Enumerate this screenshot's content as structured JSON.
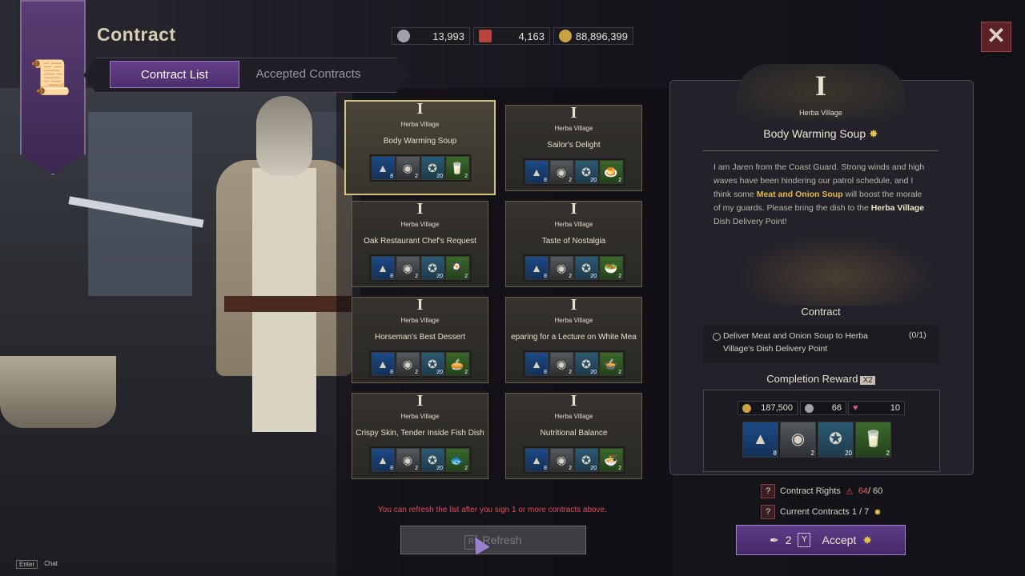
{
  "title": "Contract",
  "currency": [
    {
      "icon": "silver-coin-icon",
      "value": "13,993"
    },
    {
      "icon": "contract-ticket-icon",
      "value": "4,163"
    },
    {
      "icon": "gold-coin-icon",
      "value": "88,896,399"
    }
  ],
  "tabs": {
    "contract_list": "Contract List",
    "accepted": "Accepted Contracts"
  },
  "cards": [
    {
      "tier": "I",
      "village": "Herba Village",
      "name": "Body Warming Soup",
      "counts": [
        "8",
        "2",
        "20",
        "2"
      ]
    },
    {
      "tier": "I",
      "village": "Herba Village",
      "name": "Sailor's Delight",
      "counts": [
        "8",
        "2",
        "20",
        "2"
      ]
    },
    {
      "tier": "I",
      "village": "Herba Village",
      "name": "Oak Restaurant Chef's Request",
      "counts": [
        "8",
        "2",
        "20",
        "2"
      ]
    },
    {
      "tier": "I",
      "village": "Herba Village",
      "name": "Taste of Nostalgia",
      "counts": [
        "8",
        "2",
        "20",
        "2"
      ]
    },
    {
      "tier": "I",
      "village": "Herba Village",
      "name": "Horseman's Best Dessert",
      "counts": [
        "8",
        "2",
        "20",
        "2"
      ]
    },
    {
      "tier": "I",
      "village": "Herba Village",
      "name": "eparing for a Lecture on White Mea",
      "counts": [
        "8",
        "2",
        "20",
        "2"
      ]
    },
    {
      "tier": "I",
      "village": "Herba Village",
      "name": "Crispy Skin, Tender Inside Fish Dish",
      "counts": [
        "8",
        "2",
        "20",
        "2"
      ]
    },
    {
      "tier": "I",
      "village": "Herba Village",
      "name": "Nutritional Balance",
      "counts": [
        "8",
        "2",
        "20",
        "2"
      ]
    }
  ],
  "detail": {
    "tier": "I",
    "village": "Herba Village",
    "title": "Body Warming Soup",
    "desc_1": "I am Jaren from the Coast Guard. Strong winds and high waves have been hindering our patrol schedule, and I think some ",
    "desc_hi": "Meat and Onion Soup",
    "desc_2": " will boost the morale of my guards. Please bring the dish to the ",
    "desc_place": "Herba Village",
    "desc_3": " Dish Delivery Point!",
    "contract_heading": "Contract",
    "task": "Deliver Meat and Onion Soup to Herba Village's Dish Delivery Point",
    "task_progress": "(0/1)",
    "reward_heading": "Completion Reward",
    "reward_mult": "X2",
    "reward_currency": [
      "187,500",
      "66",
      "10"
    ],
    "reward_counts": [
      "8",
      "2",
      "20",
      "2"
    ]
  },
  "status": {
    "rights_label": "Contract Rights",
    "rights_used": "64",
    "rights_max": "/ 60",
    "current_label": "Current Contracts 1 / 7"
  },
  "refresh_note": "You can refresh the list after you sign 1 or more contracts above.",
  "refresh": {
    "key": "R",
    "label": "Refresh"
  },
  "accept": {
    "cost": "2",
    "key": "Y",
    "label": "Accept"
  },
  "chat": {
    "key": "Enter",
    "label": "Chat"
  },
  "colors": {
    "accent": "#5f3b8a",
    "warning": "#e04a5a",
    "gold": "#d5c182"
  }
}
